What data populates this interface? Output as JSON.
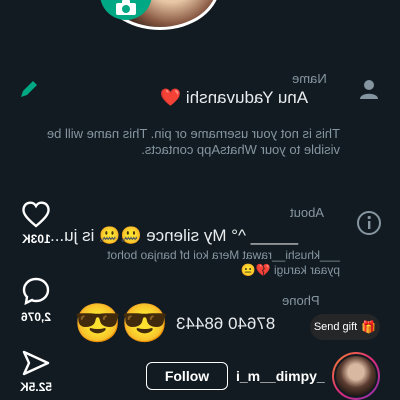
{
  "profile": {
    "name_label": "Name",
    "name_value": "Anu Yaduvanshi ❤️",
    "name_hint": "This is not your username or pin. This name will be visible to your WhatsApp contacts.",
    "about_label": "About",
    "about_value": "_____ ^° My silence 🤐🤐 is ju...",
    "about_overlay": "___khushi__rawat Mera koi bf banjao bohot pyaar karugi 💔😐",
    "phone_label": "Phone",
    "phone_value": "87640 68443",
    "emojis": "😎😎"
  },
  "rail": {
    "likes": "103K",
    "comments": "2,076",
    "shares": "52.5K"
  },
  "overlay": {
    "gift_label": "Send gift",
    "follow_label": "Follow",
    "username": "i_m__dimpy_"
  },
  "colors": {
    "background": "#121b22",
    "accent": "#00a884",
    "muted": "#8696a0"
  }
}
